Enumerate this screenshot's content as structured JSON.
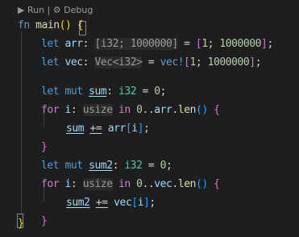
{
  "codelens": {
    "run": "▶ Run",
    "sep": " | ",
    "debug": "⚙ Debug"
  },
  "lines": {
    "l1": {
      "kw": "fn",
      "name": "main",
      "open": "() {"
    },
    "l2": {
      "let": "let",
      "var": "arr",
      "colon": ": ",
      "hint": "[i32; 1000000]",
      "eq": " = ",
      "lb": "[",
      "n1": "1",
      "semi": "; ",
      "n2": "1000000",
      "rb": "]",
      "end": ";"
    },
    "l3": {
      "let": "let",
      "var": "vec",
      "colon": ": ",
      "hint": "Vec<i32>",
      "eq": " = ",
      "mac": "vec!",
      "lb": "[",
      "n1": "1",
      "semi": "; ",
      "n2": "1000000",
      "rb": "]",
      "end": ";"
    },
    "l5": {
      "let": "let",
      "mut": "mut",
      "var": "sum",
      "colon": ": ",
      "ty": "i32",
      "eq": " = ",
      "n": "0",
      "end": ";"
    },
    "l6": {
      "for": "for",
      "var": "i",
      "colon": ": ",
      "hint": "usize",
      "in": "in",
      "n": "0",
      "range": "..",
      "obj": "arr",
      "dot": ".",
      "method": "len",
      "call": "()",
      "open": " {"
    },
    "l7": {
      "var": "sum",
      "op": "+=",
      "arr": "arr",
      "lb": "[",
      "idx": "i",
      "rb": "]",
      "end": ";"
    },
    "l8": {
      "close": "}"
    },
    "l10": {
      "let": "let",
      "mut": "mut",
      "var": "sum2",
      "colon": ": ",
      "ty": "i32",
      "eq": " = ",
      "n": "0",
      "end": ";"
    },
    "l11": {
      "for": "for",
      "var": "i",
      "colon": ": ",
      "hint": "usize",
      "in": "in",
      "n": "0",
      "range": "..",
      "obj": "vec",
      "dot": ".",
      "method": "len",
      "call": "()",
      "open": " {"
    },
    "l12": {
      "var": "sum2",
      "op": "+=",
      "arr": "vec",
      "lb": "[",
      "idx": "i",
      "rb": "]",
      "end": ";"
    },
    "l13": {
      "close": "}"
    },
    "l14": {
      "close": "}"
    }
  }
}
